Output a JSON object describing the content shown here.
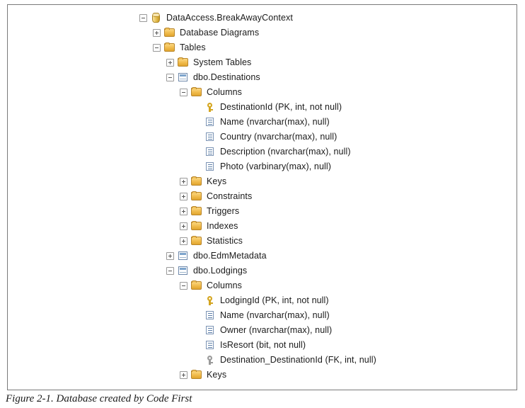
{
  "figure": {
    "caption": "Figure 2-1. Database created by Code First"
  },
  "tree": {
    "rows": [
      {
        "label": "DataAccess.BreakAwayContext",
        "toggle": "minus",
        "icon": "database-icon",
        "depth": 0
      },
      {
        "label": "Database Diagrams",
        "toggle": "plus",
        "icon": "folder-icon",
        "depth": 1
      },
      {
        "label": "Tables",
        "toggle": "minus",
        "icon": "folder-icon",
        "depth": 1
      },
      {
        "label": "System Tables",
        "toggle": "plus",
        "icon": "folder-icon",
        "depth": 2
      },
      {
        "label": "dbo.Destinations",
        "toggle": "minus",
        "icon": "table-icon",
        "depth": 2
      },
      {
        "label": "Columns",
        "toggle": "minus",
        "icon": "folder-icon",
        "depth": 3
      },
      {
        "label": "DestinationId (PK, int, not null)",
        "toggle": "none",
        "icon": "primary-key-icon",
        "depth": 4
      },
      {
        "label": "Name (nvarchar(max), null)",
        "toggle": "none",
        "icon": "column-icon",
        "depth": 4
      },
      {
        "label": "Country (nvarchar(max), null)",
        "toggle": "none",
        "icon": "column-icon",
        "depth": 4
      },
      {
        "label": "Description (nvarchar(max), null)",
        "toggle": "none",
        "icon": "column-icon",
        "depth": 4
      },
      {
        "label": "Photo (varbinary(max), null)",
        "toggle": "none",
        "icon": "column-icon",
        "depth": 4
      },
      {
        "label": "Keys",
        "toggle": "plus",
        "icon": "folder-icon",
        "depth": 3
      },
      {
        "label": "Constraints",
        "toggle": "plus",
        "icon": "folder-icon",
        "depth": 3
      },
      {
        "label": "Triggers",
        "toggle": "plus",
        "icon": "folder-icon",
        "depth": 3
      },
      {
        "label": "Indexes",
        "toggle": "plus",
        "icon": "folder-icon",
        "depth": 3
      },
      {
        "label": "Statistics",
        "toggle": "plus",
        "icon": "folder-icon",
        "depth": 3
      },
      {
        "label": "dbo.EdmMetadata",
        "toggle": "plus",
        "icon": "table-icon",
        "depth": 2
      },
      {
        "label": "dbo.Lodgings",
        "toggle": "minus",
        "icon": "table-icon",
        "depth": 2
      },
      {
        "label": "Columns",
        "toggle": "minus",
        "icon": "folder-icon",
        "depth": 3
      },
      {
        "label": "LodgingId (PK, int, not null)",
        "toggle": "none",
        "icon": "primary-key-icon",
        "depth": 4
      },
      {
        "label": "Name (nvarchar(max), null)",
        "toggle": "none",
        "icon": "column-icon",
        "depth": 4
      },
      {
        "label": "Owner (nvarchar(max), null)",
        "toggle": "none",
        "icon": "column-icon",
        "depth": 4
      },
      {
        "label": "IsResort (bit, not null)",
        "toggle": "none",
        "icon": "column-icon",
        "depth": 4
      },
      {
        "label": "Destination_DestinationId (FK, int, null)",
        "toggle": "none",
        "icon": "foreign-key-icon",
        "depth": 4
      },
      {
        "label": "Keys",
        "toggle": "plus",
        "icon": "folder-icon",
        "depth": 3
      }
    ]
  },
  "colors": {
    "frame_border": "#7a7a7a",
    "folder_gold": "#f0bb4b",
    "key_gold": "#d4a520",
    "key_silver": "#9a9a9a",
    "table_blue": "#7da4cc",
    "text": "#1a1a1a"
  }
}
